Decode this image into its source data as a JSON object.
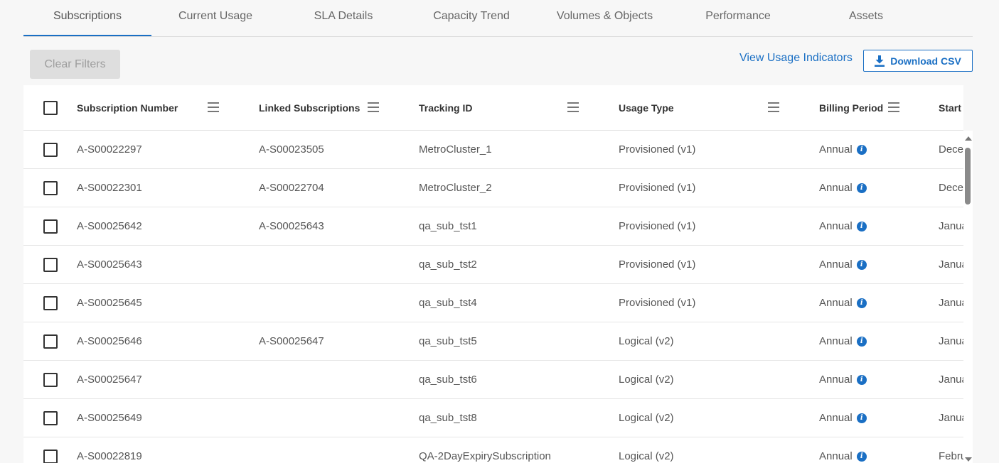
{
  "tabs": [
    {
      "label": "Subscriptions",
      "active": true
    },
    {
      "label": "Current Usage"
    },
    {
      "label": "SLA Details"
    },
    {
      "label": "Capacity Trend"
    },
    {
      "label": "Volumes & Objects"
    },
    {
      "label": "Performance"
    },
    {
      "label": "Assets"
    }
  ],
  "toolbar": {
    "clear_filters": "Clear Filters",
    "view_usage_indicators": "View Usage Indicators",
    "download_csv": "Download CSV"
  },
  "table": {
    "columns": [
      {
        "label": "Subscription Number",
        "menu": true
      },
      {
        "label": "Linked Subscriptions",
        "menu": true
      },
      {
        "label": "Tracking ID",
        "menu": true
      },
      {
        "label": "Usage Type",
        "menu": true
      },
      {
        "label": "Billing Period",
        "menu": true
      },
      {
        "label": "Start D",
        "menu": false
      }
    ],
    "rows": [
      {
        "sub": "A-S00022297",
        "linked": "A-S00023505",
        "tracking": "MetroCluster_1",
        "usage": "Provisioned (v1)",
        "billing": "Annual",
        "start": "Dece"
      },
      {
        "sub": "A-S00022301",
        "linked": "A-S00022704",
        "tracking": "MetroCluster_2",
        "usage": "Provisioned (v1)",
        "billing": "Annual",
        "start": "Dece"
      },
      {
        "sub": "A-S00025642",
        "linked": "A-S00025643",
        "tracking": "qa_sub_tst1",
        "usage": "Provisioned (v1)",
        "billing": "Annual",
        "start": "Janua"
      },
      {
        "sub": "A-S00025643",
        "linked": "",
        "tracking": "qa_sub_tst2",
        "usage": "Provisioned (v1)",
        "billing": "Annual",
        "start": "Janua"
      },
      {
        "sub": "A-S00025645",
        "linked": "",
        "tracking": "qa_sub_tst4",
        "usage": "Provisioned (v1)",
        "billing": "Annual",
        "start": "Janua"
      },
      {
        "sub": "A-S00025646",
        "linked": "A-S00025647",
        "tracking": "qa_sub_tst5",
        "usage": "Logical (v2)",
        "billing": "Annual",
        "start": "Janua"
      },
      {
        "sub": "A-S00025647",
        "linked": "",
        "tracking": "qa_sub_tst6",
        "usage": "Logical (v2)",
        "billing": "Annual",
        "start": "Janua"
      },
      {
        "sub": "A-S00025649",
        "linked": "",
        "tracking": "qa_sub_tst8",
        "usage": "Logical (v2)",
        "billing": "Annual",
        "start": "Janua"
      },
      {
        "sub": "A-S00022819",
        "linked": "",
        "tracking": "QA-2DayExpirySubscription",
        "usage": "Logical (v2)",
        "billing": "Annual",
        "start": "Febru"
      }
    ]
  },
  "icons": {
    "info": "info-icon",
    "menu": "column-menu-icon",
    "download": "download-icon"
  },
  "colors": {
    "accent": "#1a6fc4",
    "background": "#f7f7f7"
  }
}
